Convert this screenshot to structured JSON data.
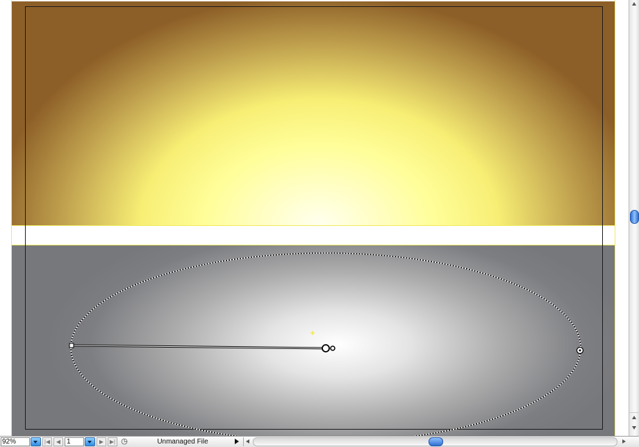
{
  "canvas": {
    "top_gradient_colors": [
      "#fffff0",
      "#fffe99",
      "#f7ee74",
      "#c9ad55",
      "#8d5f28"
    ],
    "bottom_gradient_colors": [
      "#ffffff",
      "#e4e4e4",
      "#aeaeae",
      "#7d7e82"
    ],
    "guide_color": "#f0ea5e",
    "selection_color": "#ffffff"
  },
  "statusbar": {
    "zoom_value": "92%",
    "page_value": "1",
    "status_text": "Unmanaged File",
    "status_icon": "version-cue-icon",
    "nav_icons": [
      "first-page-icon",
      "previous-page-icon",
      "next-page-icon",
      "last-page-icon"
    ]
  },
  "scrollbars": {
    "accent": "#2f6fd0",
    "vertical_position": 0.5,
    "horizontal_position": 0.5
  }
}
